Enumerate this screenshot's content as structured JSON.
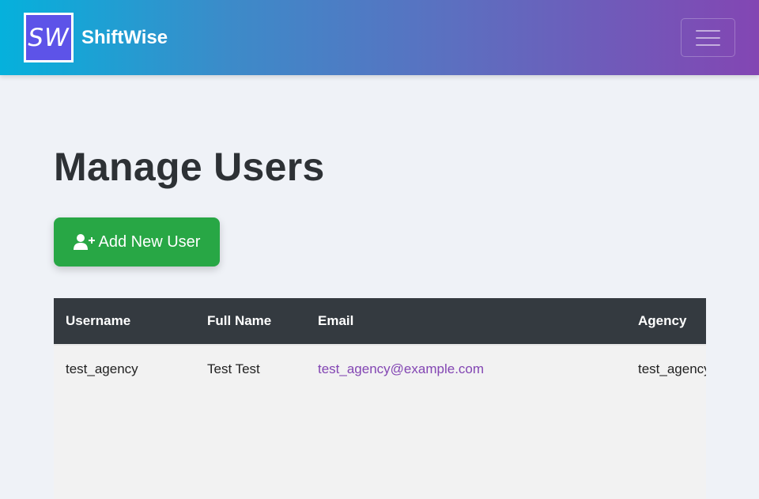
{
  "navbar": {
    "logo_text": "SW",
    "brand_name": "ShiftWise",
    "toggler_icon": "hamburger-menu-icon"
  },
  "main": {
    "title": "Manage Users",
    "add_button_label": "Add New User",
    "add_button_icon": "user-plus-icon"
  },
  "table": {
    "headers": [
      "Username",
      "Full Name",
      "Email",
      "Agency"
    ],
    "rows": [
      [
        "test_agency",
        "Test Test",
        "test_agency@example.com",
        "test_agency"
      ]
    ]
  },
  "colors": {
    "navbar_gradient_start": "#05b1dc",
    "navbar_gradient_end": "#8346b3",
    "add_button": "#28a745",
    "table_header": "#343a40",
    "link": "#8346b3",
    "page_background": "#eff2f7"
  }
}
